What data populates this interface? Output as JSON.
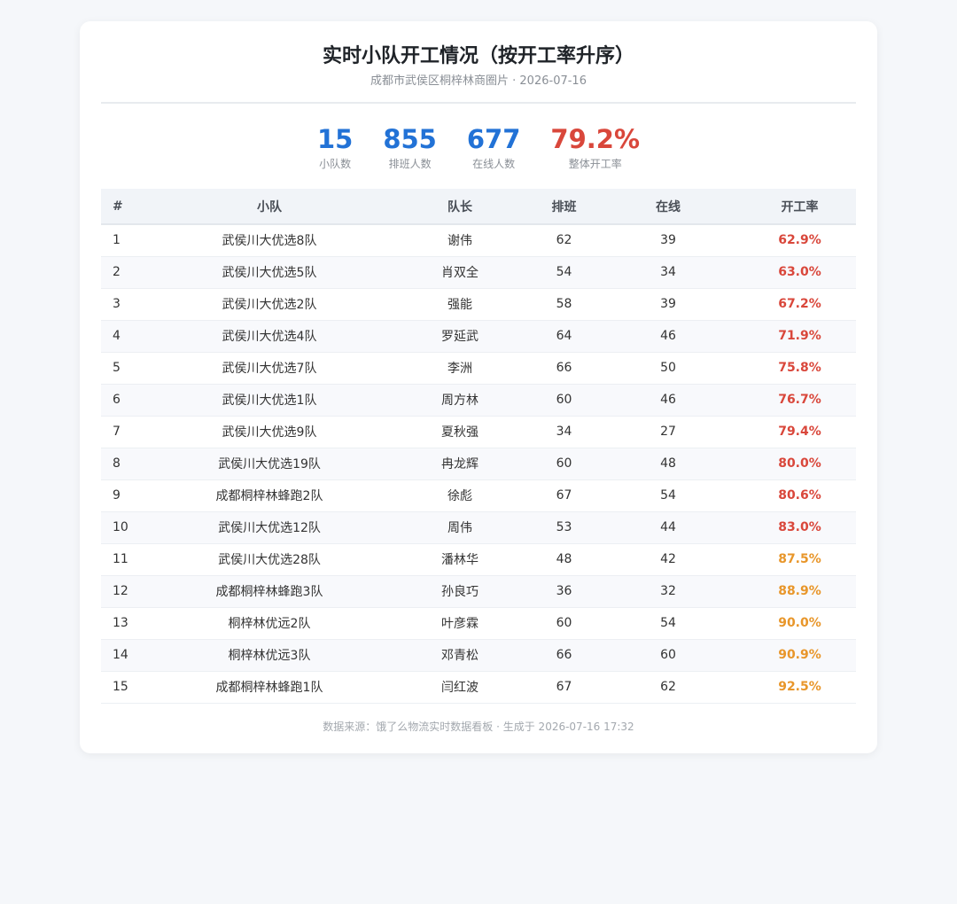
{
  "header": {
    "title": "实时小队开工情况（按开工率升序）",
    "subtitle": "成都市武侯区桐梓林商圈片 · 2026-07-16"
  },
  "stats": [
    {
      "value": "15",
      "label": "小队数",
      "color": "#2272d6"
    },
    {
      "value": "855",
      "label": "排班人数",
      "color": "#2272d6"
    },
    {
      "value": "677",
      "label": "在线人数",
      "color": "#2272d6"
    },
    {
      "value": "79.2%",
      "label": "整体开工率",
      "color": "#d9473b"
    }
  ],
  "table": {
    "columns": [
      "#",
      "小队",
      "队长",
      "排班",
      "在线",
      "开工率"
    ],
    "rows": [
      {
        "idx": "1",
        "team": "武侯川大优选8队",
        "leader": "谢伟",
        "scheduled": "62",
        "online": "39",
        "rate": "62.9%",
        "level": "red"
      },
      {
        "idx": "2",
        "team": "武侯川大优选5队",
        "leader": "肖双全",
        "scheduled": "54",
        "online": "34",
        "rate": "63.0%",
        "level": "red"
      },
      {
        "idx": "3",
        "team": "武侯川大优选2队",
        "leader": "强能",
        "scheduled": "58",
        "online": "39",
        "rate": "67.2%",
        "level": "red"
      },
      {
        "idx": "4",
        "team": "武侯川大优选4队",
        "leader": "罗延武",
        "scheduled": "64",
        "online": "46",
        "rate": "71.9%",
        "level": "red"
      },
      {
        "idx": "5",
        "team": "武侯川大优选7队",
        "leader": "李洲",
        "scheduled": "66",
        "online": "50",
        "rate": "75.8%",
        "level": "red"
      },
      {
        "idx": "6",
        "team": "武侯川大优选1队",
        "leader": "周方林",
        "scheduled": "60",
        "online": "46",
        "rate": "76.7%",
        "level": "red"
      },
      {
        "idx": "7",
        "team": "武侯川大优选9队",
        "leader": "夏秋强",
        "scheduled": "34",
        "online": "27",
        "rate": "79.4%",
        "level": "red"
      },
      {
        "idx": "8",
        "team": "武侯川大优选19队",
        "leader": "冉龙辉",
        "scheduled": "60",
        "online": "48",
        "rate": "80.0%",
        "level": "red"
      },
      {
        "idx": "9",
        "team": "成都桐梓林蜂跑2队",
        "leader": "徐彪",
        "scheduled": "67",
        "online": "54",
        "rate": "80.6%",
        "level": "red"
      },
      {
        "idx": "10",
        "team": "武侯川大优选12队",
        "leader": "周伟",
        "scheduled": "53",
        "online": "44",
        "rate": "83.0%",
        "level": "red"
      },
      {
        "idx": "11",
        "team": "武侯川大优选28队",
        "leader": "潘林华",
        "scheduled": "48",
        "online": "42",
        "rate": "87.5%",
        "level": "orange"
      },
      {
        "idx": "12",
        "team": "成都桐梓林蜂跑3队",
        "leader": "孙良巧",
        "scheduled": "36",
        "online": "32",
        "rate": "88.9%",
        "level": "orange"
      },
      {
        "idx": "13",
        "team": "桐梓林优远2队",
        "leader": "叶彦霖",
        "scheduled": "60",
        "online": "54",
        "rate": "90.0%",
        "level": "orange"
      },
      {
        "idx": "14",
        "team": "桐梓林优远3队",
        "leader": "邓青松",
        "scheduled": "66",
        "online": "60",
        "rate": "90.9%",
        "level": "orange"
      },
      {
        "idx": "15",
        "team": "成都桐梓林蜂跑1队",
        "leader": "闫红波",
        "scheduled": "67",
        "online": "62",
        "rate": "92.5%",
        "level": "orange"
      }
    ]
  },
  "footer": {
    "text": "数据来源：饿了么物流实时数据看板 · 生成于 2026-07-16 17:32"
  },
  "colors": {
    "accent": "#2272d6",
    "rate_low": "#d9473b",
    "rate_high": "#e8962a"
  }
}
